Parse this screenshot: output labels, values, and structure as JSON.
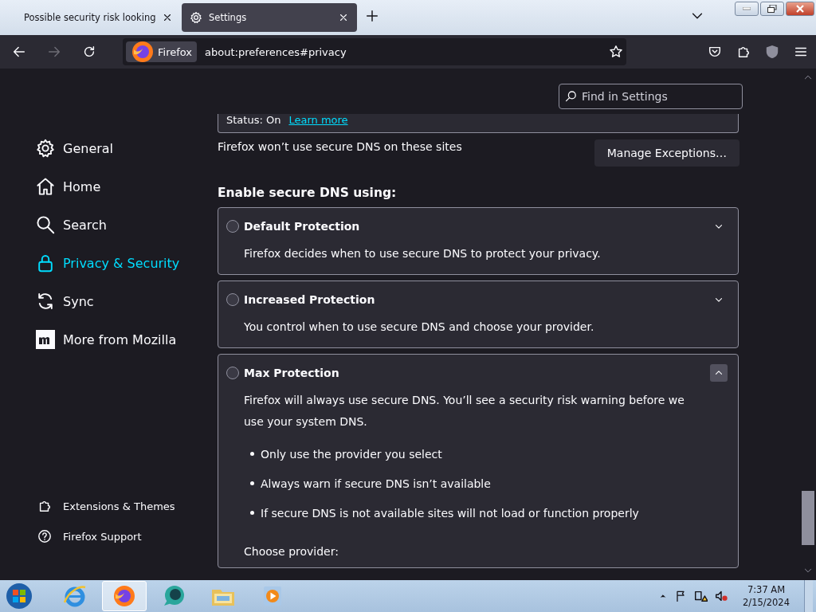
{
  "tabs": [
    {
      "title": "Possible security risk looking",
      "selected": false
    },
    {
      "title": "Settings",
      "selected": true
    }
  ],
  "url_bar": {
    "identity": "Firefox",
    "url": "about:preferences#privacy"
  },
  "search": {
    "placeholder": "Find in Settings"
  },
  "sidebar": {
    "items": [
      {
        "label": "General",
        "selected": false
      },
      {
        "label": "Home",
        "selected": false
      },
      {
        "label": "Search",
        "selected": false
      },
      {
        "label": "Privacy & Security",
        "selected": true
      },
      {
        "label": "Sync",
        "selected": false
      },
      {
        "label": "More from Mozilla",
        "selected": false
      }
    ],
    "footer": [
      {
        "label": "Extensions & Themes"
      },
      {
        "label": "Firefox Support"
      }
    ]
  },
  "status": {
    "text": "Status: On",
    "link": "Learn more"
  },
  "exceptions": {
    "text": "Firefox won’t use secure DNS on these sites",
    "button": "Manage Exceptions…"
  },
  "heading": "Enable secure DNS using:",
  "options": [
    {
      "title": "Default Protection",
      "description": "Firefox decides when to use secure DNS to protect your privacy.",
      "selected": false,
      "expanded": false
    },
    {
      "title": "Increased Protection",
      "description": "You control when to use secure DNS and choose your provider.",
      "selected": false,
      "expanded": false
    },
    {
      "title": "Max Protection",
      "description": "Firefox will always use secure DNS. You’ll see a security risk warning before we use your system DNS.",
      "selected": false,
      "expanded": true,
      "bullets": [
        "Only use the provider you select",
        "Always warn if secure DNS isn’t available",
        "If secure DNS is not available sites will not load or function properly"
      ],
      "provider_label": "Choose provider:"
    }
  ],
  "taskbar": {
    "apps": [
      {
        "selected": false
      },
      {
        "selected": true
      },
      {
        "selected": false
      },
      {
        "selected": false
      },
      {
        "selected": false
      }
    ],
    "time": "7:37 AM",
    "date": "2/15/2024"
  }
}
